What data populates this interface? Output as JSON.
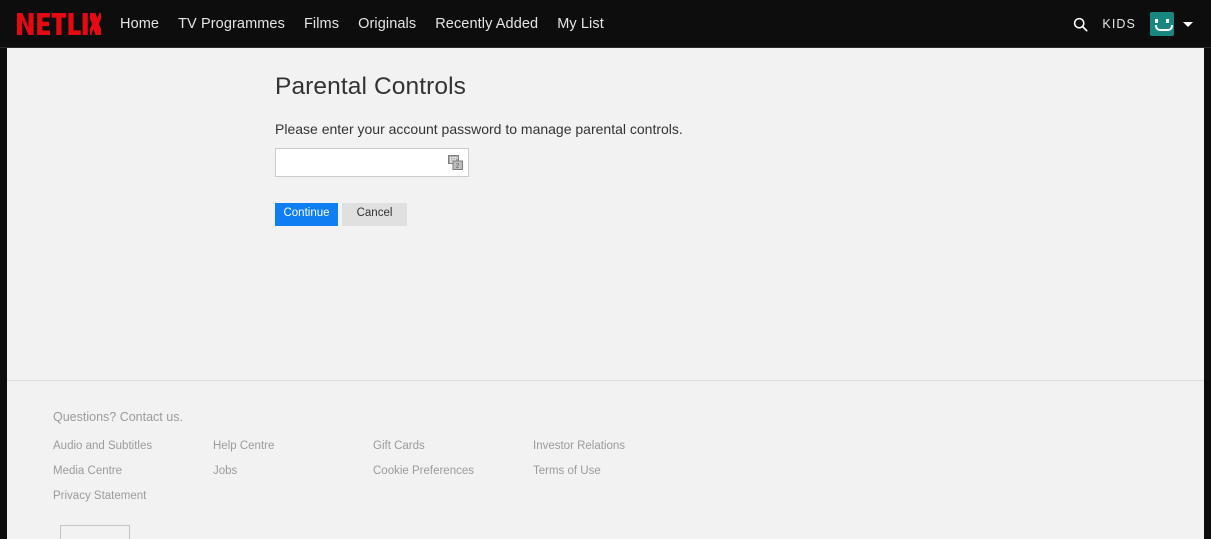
{
  "navbar": {
    "logo_text": "NETFLIX",
    "logo_color": "#e50914",
    "links": [
      {
        "label": "Home"
      },
      {
        "label": "TV Programmes"
      },
      {
        "label": "Films"
      },
      {
        "label": "Originals"
      },
      {
        "label": "Recently Added"
      },
      {
        "label": "My List"
      }
    ],
    "search_icon": "search-icon",
    "kids_label": "KIDS",
    "avatar_icon": "profile-avatar-smiley",
    "avatar_color": "#19867f",
    "caret_icon": "chevron-down-icon",
    "background": "#0d0d0d"
  },
  "main": {
    "title": "Parental Controls",
    "subtitle": "Please enter your account password to manage parental controls.",
    "password": {
      "value": "",
      "placeholder": "",
      "autofill_icon": "password-autofill-icon"
    },
    "buttons": {
      "continue_label": "Continue",
      "continue_color": "#0f7ef0",
      "cancel_label": "Cancel",
      "cancel_color": "#e0e0e0"
    },
    "background": "#f2f2f2"
  },
  "footer": {
    "contact": "Questions? Contact us.",
    "columns": [
      {
        "links": [
          {
            "label": "Audio and Subtitles"
          },
          {
            "label": "Media Centre"
          },
          {
            "label": "Privacy Statement"
          }
        ]
      },
      {
        "links": [
          {
            "label": "Help Centre"
          },
          {
            "label": "Jobs"
          }
        ]
      },
      {
        "links": [
          {
            "label": "Gift Cards"
          },
          {
            "label": "Cookie Preferences"
          }
        ]
      },
      {
        "links": [
          {
            "label": "Investor Relations"
          },
          {
            "label": "Terms of Use"
          }
        ]
      }
    ],
    "language_selector": {
      "value": ""
    }
  }
}
